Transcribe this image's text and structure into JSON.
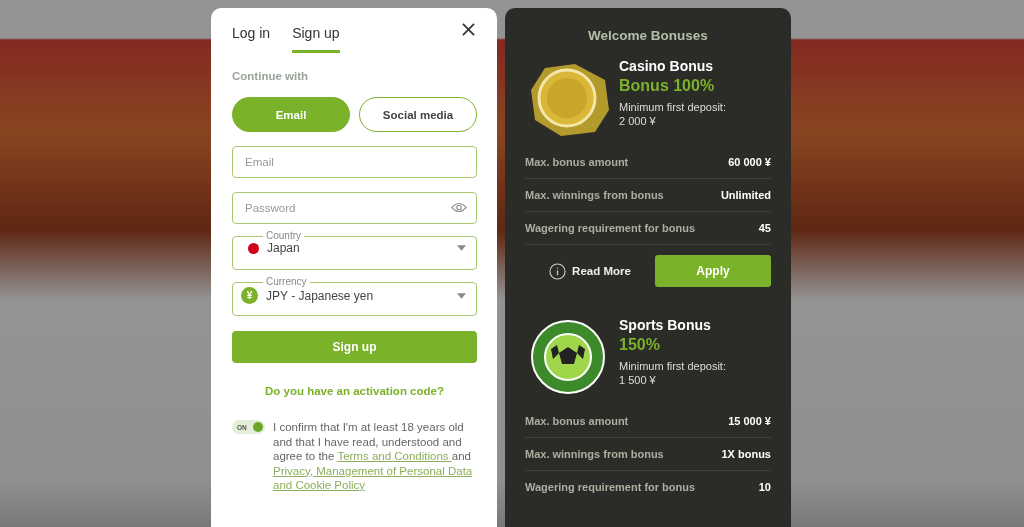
{
  "auth_modal": {
    "tabs": [
      {
        "label": "Log in",
        "selected": false
      },
      {
        "label": "Sign up",
        "selected": true
      }
    ],
    "continue_with": "Continue with",
    "methods": [
      {
        "label": "Email",
        "selected": true
      },
      {
        "label": "Social media",
        "selected": false
      }
    ],
    "fields": [
      {
        "kind": "text",
        "placeholder": "Email"
      },
      {
        "kind": "password",
        "placeholder": "Password"
      },
      {
        "kind": "country_select",
        "label": "Country",
        "value": "Japan"
      },
      {
        "kind": "currency_select",
        "label": "Currency",
        "value": "JPY - Japanese yen",
        "symbol": "¥"
      }
    ],
    "submit": "Sign up",
    "activation_link": "Do you have an activation code?",
    "consent": {
      "toggle_label": "ON",
      "on": true,
      "parts": [
        {
          "kind": "text",
          "text": "I confirm that I'm at least 18 years old and that I have read, understood and agree to the "
        },
        {
          "kind": "link",
          "text": "Terms and Conditions "
        },
        {
          "kind": "text",
          "text": "and "
        },
        {
          "kind": "link",
          "text": "Privacy, Management of Personal Data and Cookie Policy"
        }
      ]
    }
  },
  "bonuses_panel": {
    "title": "Welcome Bonuses",
    "bonuses": [
      {
        "kind": "casino",
        "title": "Casino Bonus",
        "value": "Bonus 100%",
        "deposit_label": "Minimum first deposit:",
        "deposit_amount": "2 000 ¥",
        "rows": [
          {
            "label": "Max. bonus amount",
            "value": "60 000 ¥"
          },
          {
            "label": "Max. winnings from bonus",
            "value": "Unlimited"
          },
          {
            "label": "Wagering requirement for bonus",
            "value": "45"
          }
        ],
        "read_more": "Read More",
        "apply": "Apply"
      },
      {
        "kind": "sports",
        "title": "Sports Bonus",
        "value": "150%",
        "deposit_label": "Minimum first deposit:",
        "deposit_amount": "1 500 ¥",
        "rows": [
          {
            "label": "Max. bonus amount",
            "value": "15 000 ¥"
          },
          {
            "label": "Max. winnings from bonus",
            "value": "1X bonus"
          },
          {
            "label": "Wagering requirement for bonus",
            "value": "10"
          }
        ]
      }
    ]
  }
}
